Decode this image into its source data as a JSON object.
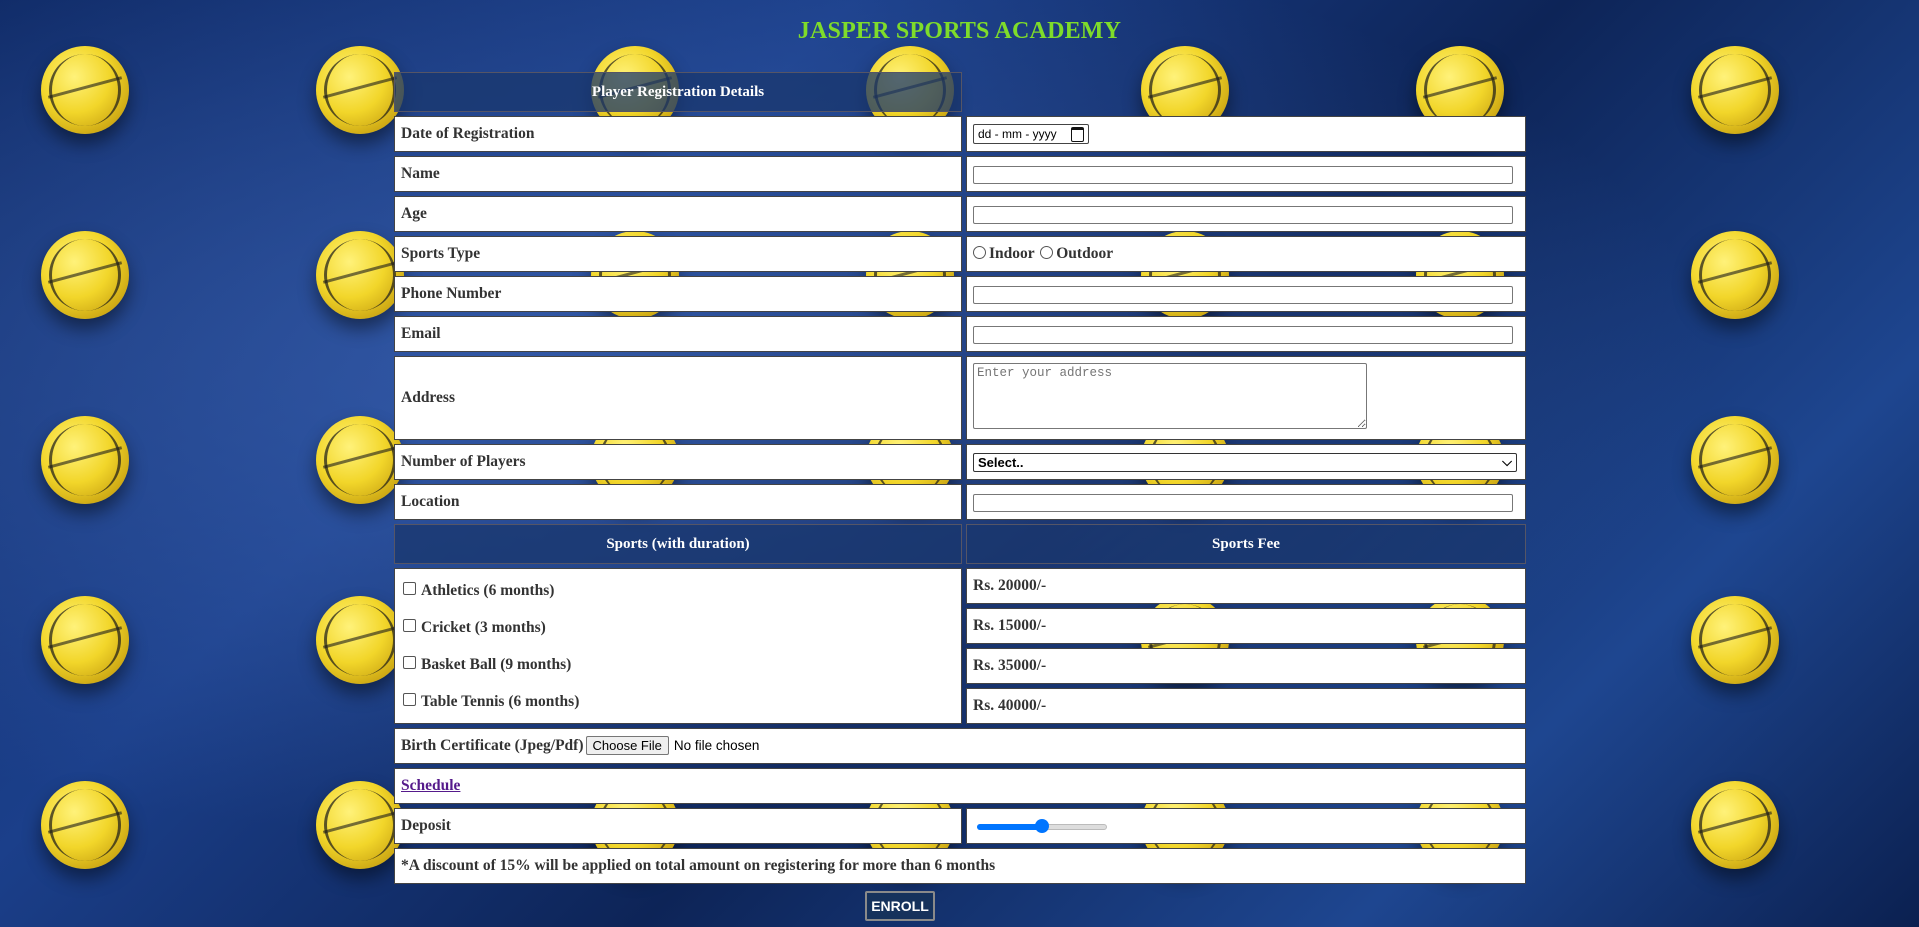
{
  "title": "JASPER SPORTS ACADEMY",
  "section1_header": "Player Registration Details",
  "fields": {
    "date_label": "Date of Registration",
    "date_placeholder": "dd - mm - yyyy",
    "name_label": "Name",
    "age_label": "Age",
    "sports_type_label": "Sports Type",
    "sports_type_options": [
      "Indoor",
      "Outdoor"
    ],
    "phone_label": "Phone Number",
    "email_label": "Email",
    "address_label": "Address",
    "address_placeholder": "Enter your address",
    "players_label": "Number of Players",
    "players_selected": "Select..",
    "location_label": "Location"
  },
  "sports_header": "Sports (with duration)",
  "fee_header": "Sports Fee",
  "sports": [
    {
      "label": "Athletics (6 months)",
      "fee": "Rs. 20000/-"
    },
    {
      "label": "Cricket (3 months)",
      "fee": "Rs. 15000/-"
    },
    {
      "label": "Basket Ball (9 months)",
      "fee": "Rs. 35000/-"
    },
    {
      "label": "Table Tennis (6 months)",
      "fee": "Rs. 40000/-"
    }
  ],
  "birth_cert": {
    "label": "Birth Certificate (Jpeg/Pdf)",
    "button": "Choose File",
    "status": "No file chosen"
  },
  "schedule_link": "Schedule",
  "deposit": {
    "label": "Deposit",
    "value_percent": 50
  },
  "note": "*A discount of 15% will be applied on total amount on registering for more than 6 months",
  "enroll_button": "ENROLL",
  "colors": {
    "title": "#7fdc2a",
    "header_bg": "#19376e",
    "slider": "#0075ff"
  }
}
